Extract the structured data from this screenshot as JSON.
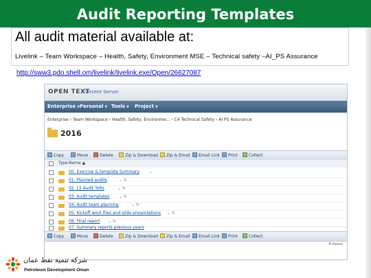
{
  "slide": {
    "title": "Audit Reporting Templates",
    "headline": "All audit material available at:",
    "path": "Livelink – Team Workspace – Health, Safety, Environment MSE – Technical safety –AI_PS Assurance",
    "url": "http://sww3.pdo.shell.om/livelink/livelink.exe/Open/26627087"
  },
  "livelink": {
    "logo": "OPEN TEXT",
    "server": "Content Server",
    "menu": [
      "Enterprise",
      "Personal",
      "Tools",
      "Project"
    ],
    "breadcrumb": "Enterprise › Team Workspace › Health, Safety, Environme... › C4 Technical Safety › AI PS Assurance",
    "folder": "2016",
    "toolbar_top": [
      "Copy",
      "Move",
      "Delete",
      "Zip & Download",
      "Zip & Email",
      "Email Link",
      "Print",
      "Collect"
    ],
    "toolbar_bottom": [
      "Copy",
      "Move",
      "Delete",
      "Zip & Download",
      "Zip & Email",
      "Email Link",
      "Print",
      "Collect"
    ],
    "columns": {
      "type": "Type",
      "name": "Name ▲"
    },
    "rows": [
      {
        "name": "00. Exercise & template Summary"
      },
      {
        "name": "01. Planned audits"
      },
      {
        "name": "02. L3 Audit ToRs"
      },
      {
        "name": "03. Audit templates"
      },
      {
        "name": "04. Audit team planning"
      },
      {
        "name": "05. Kickoff work files and slide presentations"
      },
      {
        "name": "06. Final report"
      },
      {
        "name": "07. Summary reports previous years"
      }
    ],
    "item_count": "8 items"
  },
  "footer": {
    "arabic": "شركة تنمية نفط عمان",
    "company": "Petroleum Development Oman"
  },
  "colors": {
    "title_bar": "#0b7d3a",
    "link": "#0000cc",
    "menu_bar": "#4a6b8c"
  }
}
